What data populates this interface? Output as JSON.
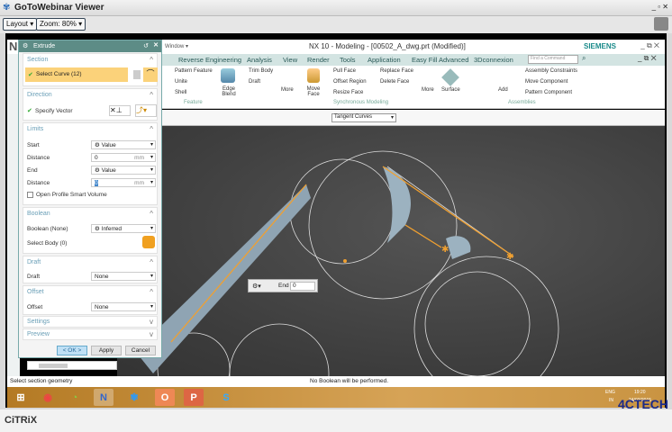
{
  "viewer": {
    "title": "GoToWebinar Viewer",
    "layout_label": "Layout",
    "zoom_label": "Zoom: 80%"
  },
  "nx": {
    "title": "NX 10 - Modeling - [00502_A_dwg.prt (Modified)]",
    "brand": "SIEMENS",
    "window_menu": "Window",
    "menu_tabs": [
      "Reverse Engineering",
      "Analysis",
      "View",
      "Render",
      "Tools",
      "Application",
      "Easy Fill Advanced",
      "3Dconnexion"
    ],
    "command_finder_placeholder": "Find a Command",
    "ribbon": {
      "pattern_feature": "Pattern Feature",
      "unite": "Unite",
      "shell": "Shell",
      "edge_blend": "Edge Blend",
      "trim_body": "Trim Body",
      "draft": "Draft",
      "more1": "More",
      "move_face": "Move Face",
      "pull_face": "Pull Face",
      "offset_region": "Offset Region",
      "resize_face": "Resize Face",
      "replace_face": "Replace Face",
      "delete_face": "Delete Face",
      "more2": "More",
      "surface": "Surface",
      "add": "Add",
      "assembly_constraints": "Assembly Constraints",
      "move_component": "Move Component",
      "pattern_component": "Pattern Component",
      "group_feature": "Feature",
      "group_sync": "Synchronous Modeling",
      "group_assemblies": "Assemblies"
    },
    "selection_filter": "Tangent Curves",
    "status_left": "Select section geometry",
    "status_center": "No Boolean will be performed."
  },
  "extrude": {
    "title": "Extrude",
    "section": {
      "header": "Section",
      "select_curve": "Select Curve (12)"
    },
    "direction": {
      "header": "Direction",
      "specify_vector": "Specify Vector"
    },
    "limits": {
      "header": "Limits",
      "start_label": "Start",
      "start_value": "Value",
      "distance1_label": "Distance",
      "distance1_value": "0",
      "unit1": "mm",
      "end_label": "End",
      "end_value": "Value",
      "distance2_label": "Distance",
      "distance2_value": "0",
      "unit2": "mm",
      "open_profile": "Open Profile Smart Volume"
    },
    "boolean": {
      "header": "Boolean",
      "boolean_label": "Boolean (None)",
      "boolean_value": "Inferred",
      "select_body": "Select Body (0)"
    },
    "draft": {
      "header": "Draft",
      "draft_label": "Draft",
      "draft_value": "None"
    },
    "offset": {
      "header": "Offset",
      "offset_label": "Offset",
      "offset_value": "None"
    },
    "settings": "Settings",
    "preview": "Preview",
    "ok": "< OK >",
    "apply": "Apply",
    "cancel": "Cancel"
  },
  "float_widget": {
    "label": "End",
    "value": "0"
  },
  "taskbar": {
    "lang": "ENG",
    "lang2": "IN",
    "time": "19:20",
    "date": "24/03/2015"
  },
  "citrix": "CiTRiX",
  "watermark": "4CTECH"
}
